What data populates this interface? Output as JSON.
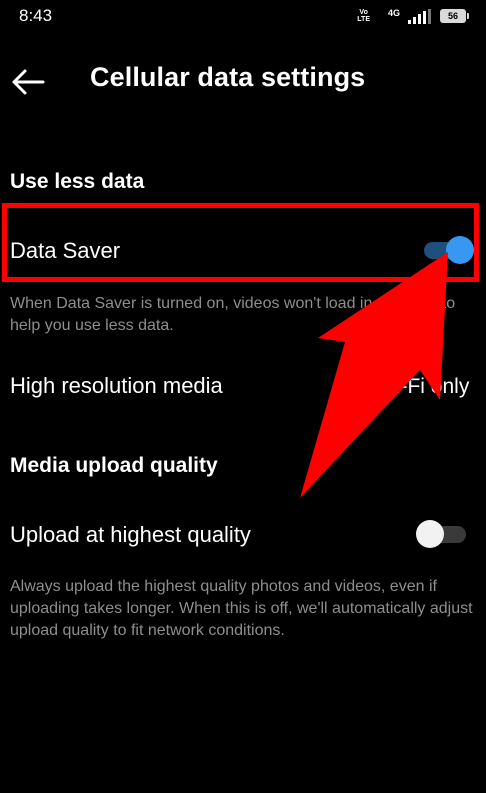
{
  "status_bar": {
    "time": "8:43",
    "volte_top": "Vo",
    "volte_bottom": "LTE",
    "network": "4G",
    "battery": "56"
  },
  "header": {
    "title": "Cellular data settings"
  },
  "sections": {
    "use_less_data": {
      "title": "Use less data",
      "data_saver": {
        "label": "Data Saver",
        "enabled": true,
        "description": "When Data Saver is turned on, videos won't load in advance to help you use less data."
      },
      "high_resolution_media": {
        "label": "High resolution media",
        "value": "Wi-Fi only"
      }
    },
    "media_upload_quality": {
      "title": "Media upload quality",
      "upload_highest_quality": {
        "label": "Upload at highest quality",
        "enabled": false,
        "description": "Always upload the highest quality photos and videos, even if uploading takes longer. When this is off, we'll automatically adjust upload quality to fit network conditions."
      }
    }
  },
  "colors": {
    "background": "#000000",
    "toggle_on_thumb": "#3897f0",
    "toggle_on_track": "#1f4f7c",
    "annotation": "#ff0000",
    "secondary_text": "#8e8e8e"
  }
}
